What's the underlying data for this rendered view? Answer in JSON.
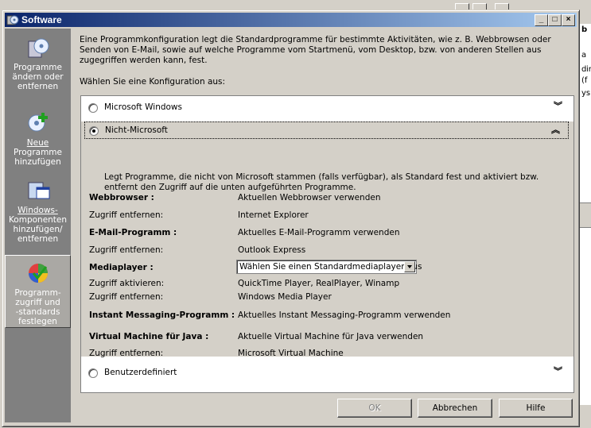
{
  "window": {
    "title": "Software",
    "minimize_glyph": "_",
    "maximize_glyph": "□",
    "close_glyph": "×"
  },
  "background_window": {
    "fragments": [
      "b",
      "a",
      "d",
      "ir",
      "(f",
      "ys"
    ]
  },
  "sidebar": {
    "items": [
      {
        "label_line1": "Programme",
        "label_line2": "ändern oder",
        "label_line3": "entfernen",
        "icon": "cd-box-icon"
      },
      {
        "label_line1": "Neue",
        "label_line2": "Programme",
        "label_line3": "hinzufügen",
        "icon": "cd-add-icon"
      },
      {
        "label_line1": "Windows-",
        "label_line2": "Komponenten",
        "label_line3": "hinzufügen/",
        "label_line4": "entfernen",
        "icon": "windows-components-icon"
      },
      {
        "label_line1": "Programm-",
        "label_line2": "zugriff und",
        "label_line3": "-standards",
        "label_line4": "festlegen",
        "icon": "program-access-icon"
      }
    ]
  },
  "intro": "Eine Programmkonfiguration legt die Standardprogramme für bestimmte Aktivitäten, wie z. B. Webbrowsen oder Senden von E-Mail, sowie auf welche Programme vom Startmenü, vom Desktop, bzw. von anderen Stellen aus zugegriffen werden kann, fest.",
  "choose_label": "Wählen Sie eine Konfiguration aus:",
  "options": [
    {
      "label": "Microsoft Windows",
      "selected": false
    },
    {
      "label": "Nicht-Microsoft",
      "selected": true
    },
    {
      "label": "Benutzerdefiniert",
      "selected": false
    }
  ],
  "expanded": {
    "description": "Legt Programme, die nicht von Microsoft stammen (falls verfügbar), als Standard fest und aktiviert bzw. entfernt den Zugriff auf die unten aufgeführten Programme.",
    "rows": [
      {
        "key": "Webbrowser :",
        "value": "Aktuellen Webbrowser verwenden"
      },
      {
        "key": "Zugriff entfernen:",
        "value": "Internet Explorer"
      },
      {
        "key": "E-Mail-Programm :",
        "value": "Aktuelles E-Mail-Programm verwenden"
      },
      {
        "key": "Zugriff entfernen:",
        "value": "Outlook Express"
      },
      {
        "key": "Mediaplayer :",
        "value": "Wählen Sie einen Standardmediaplayer aus"
      },
      {
        "key": "Zugriff aktivieren:",
        "value": "QuickTime Player, RealPlayer, Winamp"
      },
      {
        "key": "Zugriff entfernen:",
        "value": "Windows Media Player"
      },
      {
        "key": "Instant Messaging-Programm :",
        "value": "Aktuelles Instant Messaging-Programm verwenden"
      },
      {
        "key": "Virtual Machine für Java :",
        "value": "Aktuelle Virtual Machine für Java verwenden"
      },
      {
        "key": "Zugriff entfernen:",
        "value": "Microsoft Virtual Machine"
      }
    ]
  },
  "buttons": {
    "ok": "OK",
    "cancel": "Abbrechen",
    "help": "Hilfe"
  }
}
